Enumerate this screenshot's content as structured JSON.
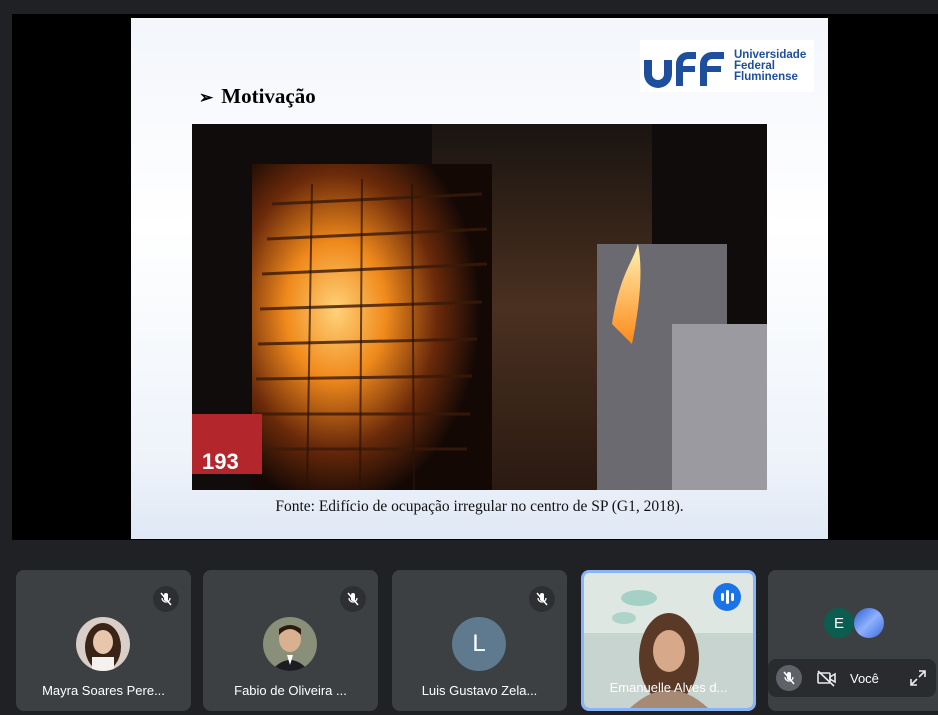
{
  "slide": {
    "logo_line1": "Universidade",
    "logo_line2": "Federal",
    "logo_line3": "Fluminense",
    "heading_bullet": "➢",
    "heading": "Motivação",
    "caption": "Fonte: Edifício de ocupação irregular no centro de SP (G1, 2018).",
    "sign_number": "193"
  },
  "participants": [
    {
      "name": "Mayra Soares Pere...",
      "muted": true
    },
    {
      "name": "Fabio de Oliveira ...",
      "muted": true
    },
    {
      "name": "Luis Gustavo Zela...",
      "initial": "L",
      "muted": true
    },
    {
      "name": "Emanuelle Alves d...",
      "speaking": true
    }
  ],
  "self": {
    "initial": "E",
    "label": "Você"
  },
  "colors": {
    "background": "#202124",
    "tile": "#3c4043",
    "active_border": "#8ab4f8",
    "speaking": "#1a73e8",
    "uff_blue": "#1d4f9c"
  },
  "icons": [
    "mic-off-icon",
    "speaking-indicator-icon",
    "camera-off-icon",
    "expand-icon",
    "uff-logo"
  ]
}
